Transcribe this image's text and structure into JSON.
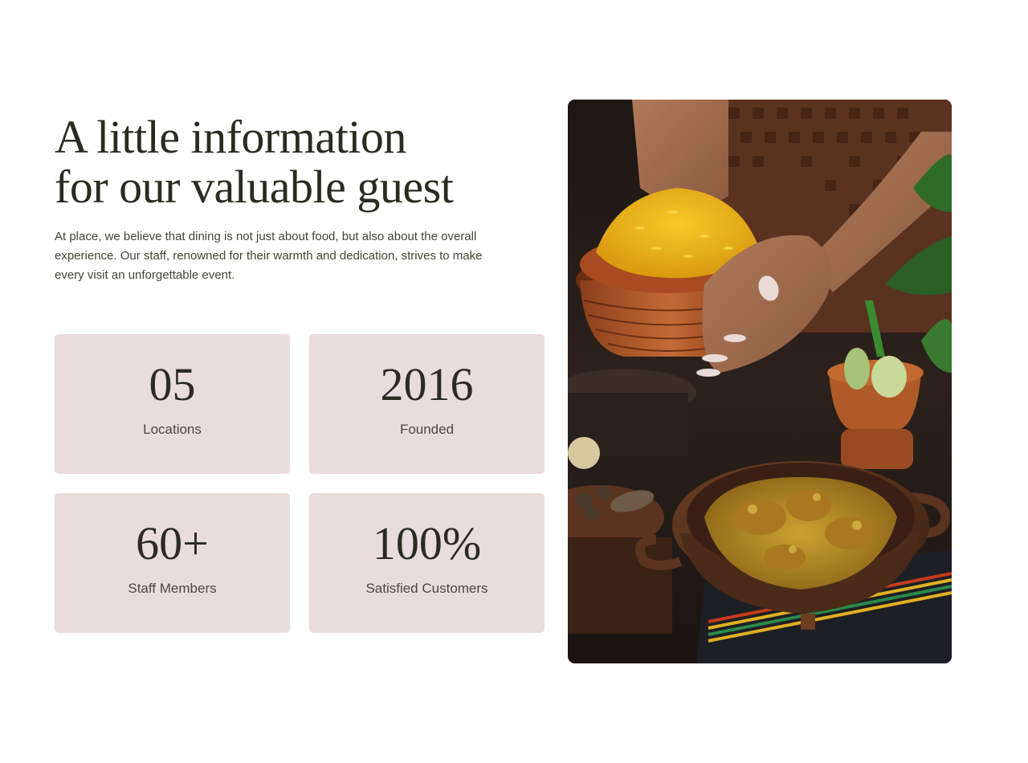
{
  "heading": {
    "line1": "A little information",
    "line2": "for our valuable guest"
  },
  "intro": "At place, we believe that dining is not just about food, but also about the overall experience. Our staff, renowned for their warmth and dedication, strives to make every visit an unforgettable event.",
  "stats": [
    {
      "value": "05",
      "label": "Locations"
    },
    {
      "value": "2016",
      "label": "Founded"
    },
    {
      "value": "60+",
      "label": "Staff Members"
    },
    {
      "value": "100%",
      "label": "Satisfied Customers"
    }
  ],
  "colors": {
    "card_background": "#e8dddc",
    "heading_text": "#2b2b22",
    "body_text": "#444338"
  }
}
